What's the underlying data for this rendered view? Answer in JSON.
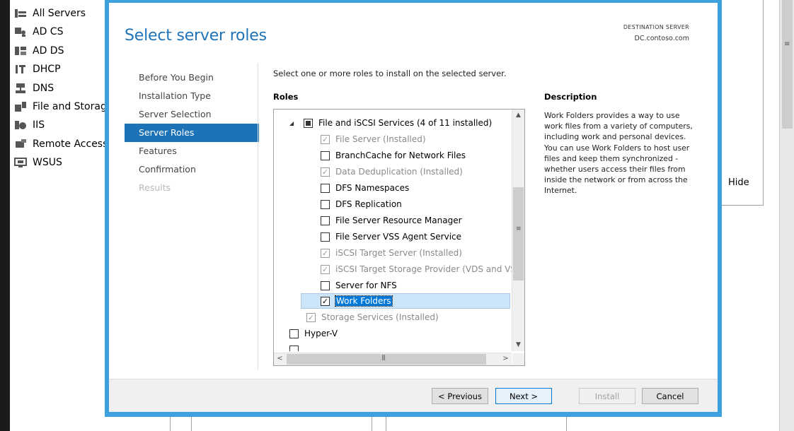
{
  "background": {
    "nav_items": [
      {
        "label": "All Servers",
        "icon": "all-servers-icon"
      },
      {
        "label": "AD CS",
        "icon": "ad-cs-icon"
      },
      {
        "label": "AD DS",
        "icon": "ad-ds-icon"
      },
      {
        "label": "DHCP",
        "icon": "dhcp-icon"
      },
      {
        "label": "DNS",
        "icon": "dns-icon"
      },
      {
        "label": "File and Storag",
        "icon": "file-storage-icon"
      },
      {
        "label": "IIS",
        "icon": "iis-icon"
      },
      {
        "label": "Remote Access",
        "icon": "remote-access-icon"
      },
      {
        "label": "WSUS",
        "icon": "wsus-icon"
      }
    ],
    "hide_label": "Hide"
  },
  "wizard": {
    "title": "Select server roles",
    "destination_caption": "DESTINATION SERVER",
    "destination_server": "DC.contoso.com",
    "accent_color": "#3ea0dc",
    "steps": [
      {
        "label": "Before You Begin",
        "state": "normal"
      },
      {
        "label": "Installation Type",
        "state": "normal"
      },
      {
        "label": "Server Selection",
        "state": "normal"
      },
      {
        "label": "Server Roles",
        "state": "active"
      },
      {
        "label": "Features",
        "state": "normal"
      },
      {
        "label": "Confirmation",
        "state": "normal"
      },
      {
        "label": "Results",
        "state": "disabled"
      }
    ],
    "instruction": "Select one or more roles to install on the selected server.",
    "roles_heading": "Roles",
    "roles": [
      {
        "label": "File and iSCSI Services (4 of 11 installed)",
        "check": "partial",
        "installed": false
      },
      {
        "label": "File Server (Installed)",
        "check": "checked",
        "installed": true
      },
      {
        "label": "BranchCache for Network Files",
        "check": "unchecked",
        "installed": false
      },
      {
        "label": "Data Deduplication (Installed)",
        "check": "checked",
        "installed": true
      },
      {
        "label": "DFS Namespaces",
        "check": "unchecked",
        "installed": false
      },
      {
        "label": "DFS Replication",
        "check": "unchecked",
        "installed": false
      },
      {
        "label": "File Server Resource Manager",
        "check": "unchecked",
        "installed": false
      },
      {
        "label": "File Server VSS Agent Service",
        "check": "unchecked",
        "installed": false
      },
      {
        "label": "iSCSI Target Server (Installed)",
        "check": "checked",
        "installed": true
      },
      {
        "label": "iSCSI Target Storage Provider (VDS and VSS",
        "check": "checked",
        "installed": true
      },
      {
        "label": "Server for NFS",
        "check": "unchecked",
        "installed": false
      },
      {
        "label": "Work Folders",
        "check": "checked",
        "installed": false,
        "selected": true
      },
      {
        "label": "Storage Services (Installed)",
        "check": "checked",
        "installed": true
      },
      {
        "label": "Hyper-V",
        "check": "unchecked",
        "installed": false
      }
    ],
    "description_heading": "Description",
    "description": "Work Folders provides a way to use work files from a variety of computers, including work and personal devices. You can use Work Folders to host user files and keep them synchronized - whether users access their files from inside the network or from across the Internet.",
    "buttons": {
      "previous": "< Previous",
      "next": "Next >",
      "install": "Install",
      "cancel": "Cancel"
    }
  }
}
